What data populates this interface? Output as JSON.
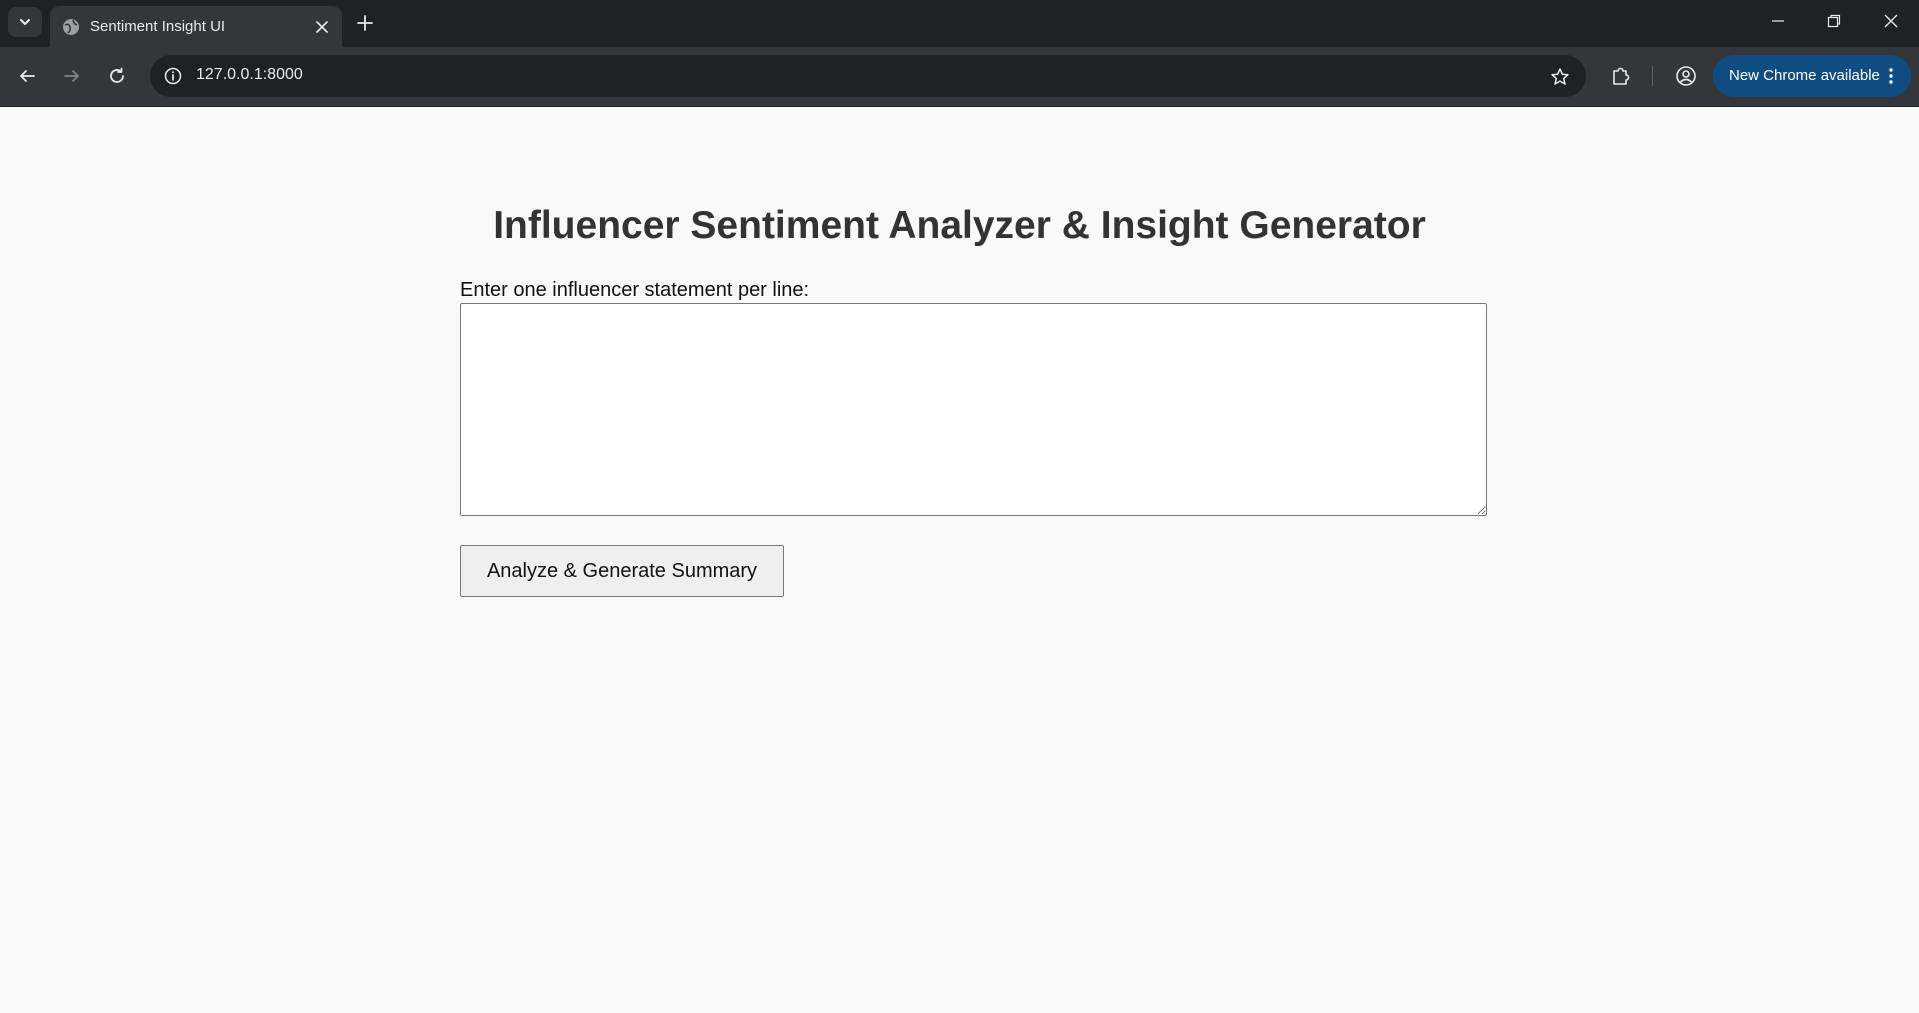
{
  "browser": {
    "tab": {
      "title": "Sentiment Insight UI",
      "favicon": "globe-icon"
    },
    "url": "127.0.0.1:8000",
    "update_button_label": "New Chrome available",
    "theme": {
      "tabbar": "#202124",
      "toolbar": "#35363a",
      "omnibox": "#202124",
      "update_button": "#0f4c81"
    }
  },
  "page": {
    "title": "Influencer Sentiment Analyzer & Insight Generator",
    "input_label": "Enter one influencer statement per line:",
    "input_value": "",
    "analyze_button_label": "Analyze & Generate Summary",
    "background": "#f9f9f9"
  }
}
